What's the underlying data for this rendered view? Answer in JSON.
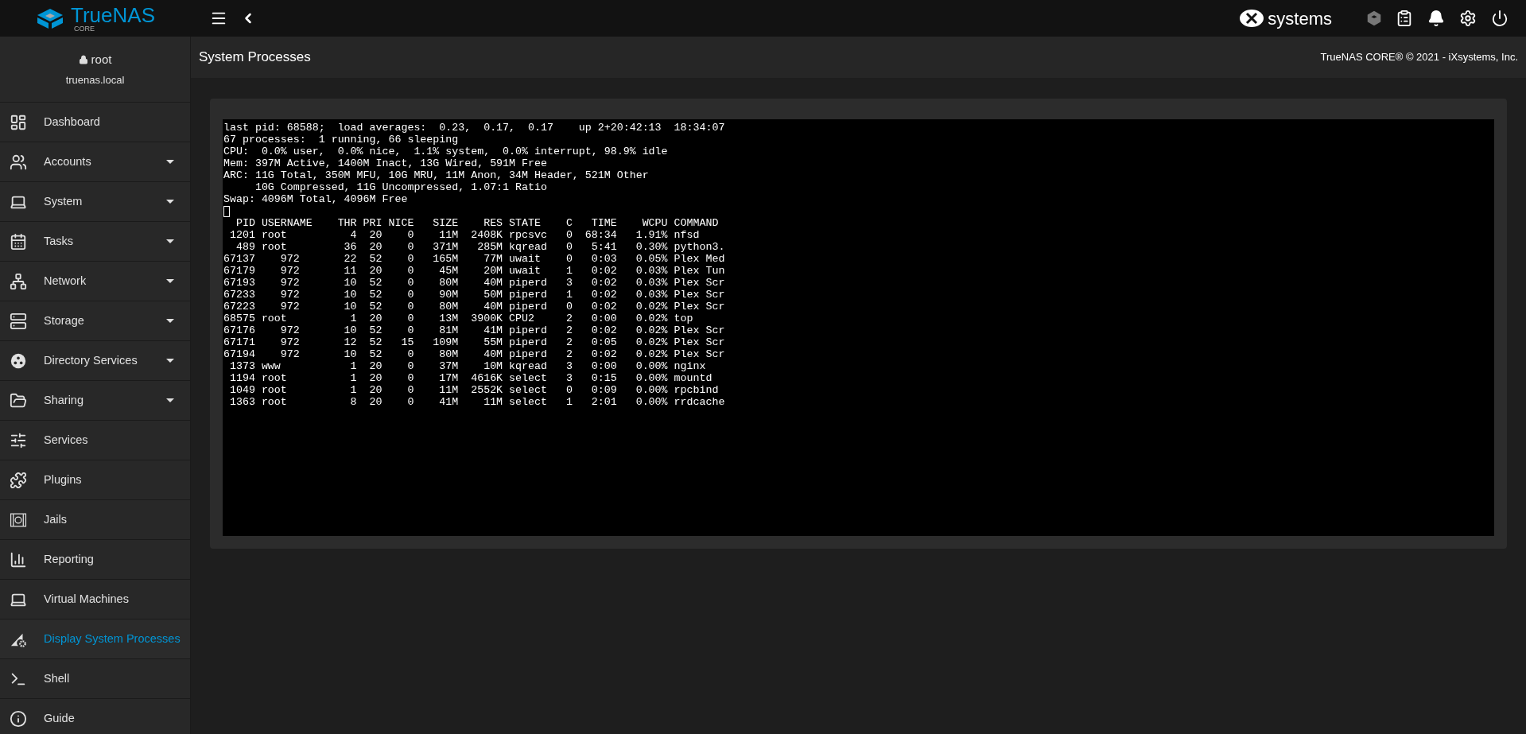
{
  "topbar": {
    "brand": "TrueNAS",
    "brand_sub": "CORE",
    "vendor": "systems"
  },
  "user": {
    "name": "root",
    "host": "truenas.local"
  },
  "sidebar": {
    "items": [
      {
        "label": "Dashboard",
        "expandable": false,
        "selected": false
      },
      {
        "label": "Accounts",
        "expandable": true,
        "selected": false
      },
      {
        "label": "System",
        "expandable": true,
        "selected": false
      },
      {
        "label": "Tasks",
        "expandable": true,
        "selected": false
      },
      {
        "label": "Network",
        "expandable": true,
        "selected": false
      },
      {
        "label": "Storage",
        "expandable": true,
        "selected": false
      },
      {
        "label": "Directory Services",
        "expandable": true,
        "selected": false
      },
      {
        "label": "Sharing",
        "expandable": true,
        "selected": false
      },
      {
        "label": "Services",
        "expandable": false,
        "selected": false
      },
      {
        "label": "Plugins",
        "expandable": false,
        "selected": false
      },
      {
        "label": "Jails",
        "expandable": false,
        "selected": false
      },
      {
        "label": "Reporting",
        "expandable": false,
        "selected": false
      },
      {
        "label": "Virtual Machines",
        "expandable": false,
        "selected": false
      },
      {
        "label": "Display System Processes",
        "expandable": false,
        "selected": true
      },
      {
        "label": "Shell",
        "expandable": false,
        "selected": false
      },
      {
        "label": "Guide",
        "expandable": false,
        "selected": false
      }
    ]
  },
  "page": {
    "title": "System Processes",
    "copyright": "TrueNAS CORE® © 2021 - iXsystems, Inc."
  },
  "terminal": {
    "lines": [
      "last pid: 68588;  load averages:  0.23,  0.17,  0.17    up 2+20:42:13  18:34:07",
      "67 processes:  1 running, 66 sleeping",
      "CPU:  0.0% user,  0.0% nice,  1.1% system,  0.0% interrupt, 98.9% idle",
      "Mem: 397M Active, 1400M Inact, 13G Wired, 591M Free",
      "ARC: 11G Total, 350M MFU, 10G MRU, 11M Anon, 34M Header, 521M Other",
      "     10G Compressed, 11G Uncompressed, 1.07:1 Ratio",
      "Swap: 4096M Total, 4096M Free"
    ],
    "header": "  PID USERNAME    THR PRI NICE   SIZE    RES STATE    C   TIME    WCPU COMMAND",
    "rows": [
      " 1201 root          4  20    0    11M  2408K rpcsvc   0  68:34   1.91% nfsd",
      "  489 root         36  20    0   371M   285M kqread   0   5:41   0.30% python3.",
      "67137    972       22  52    0   165M    77M uwait    0   0:03   0.05% Plex Med",
      "67179    972       11  20    0    45M    20M uwait    1   0:02   0.03% Plex Tun",
      "67193    972       10  52    0    80M    40M piperd   3   0:02   0.03% Plex Scr",
      "67233    972       10  52    0    90M    50M piperd   1   0:02   0.03% Plex Scr",
      "67223    972       10  52    0    80M    40M piperd   0   0:02   0.02% Plex Scr",
      "68575 root          1  20    0    13M  3900K CPU2     2   0:00   0.02% top",
      "67176    972       10  52    0    81M    41M piperd   2   0:02   0.02% Plex Scr",
      "67171    972       12  52   15   109M    55M piperd   2   0:05   0.02% Plex Scr",
      "67194    972       10  52    0    80M    40M piperd   2   0:02   0.02% Plex Scr",
      " 1373 www           1  20    0    37M    10M kqread   3   0:00   0.00% nginx",
      " 1194 root          1  20    0    17M  4616K select   3   0:15   0.00% mountd",
      " 1049 root          1  20    0    11M  2552K select   0   0:09   0.00% rpcbind",
      " 1363 root          8  20    0    41M    11M select   1   2:01   0.00% rrdcache"
    ]
  }
}
